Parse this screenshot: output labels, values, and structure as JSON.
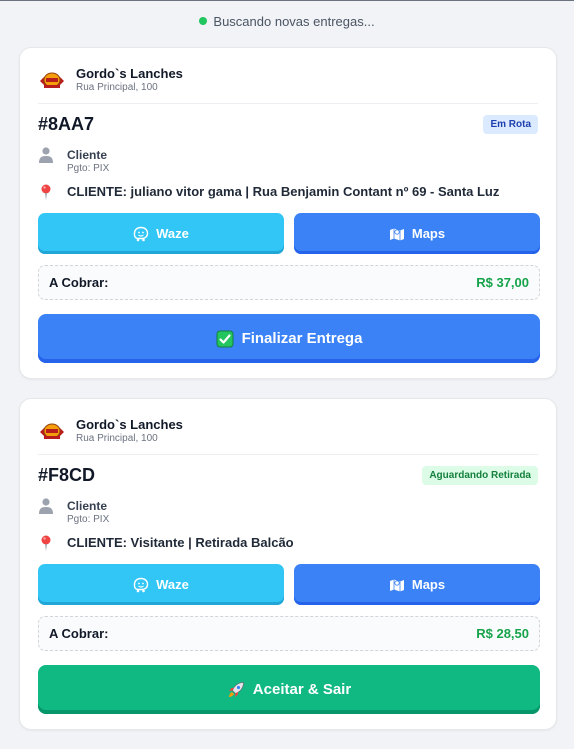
{
  "status": {
    "text": "Buscando novas entregas..."
  },
  "colors": {
    "accent": "#3b82f6",
    "waze": "#31c6f5",
    "success": "#10b981",
    "money": "#16a34a"
  },
  "orders": [
    {
      "store_name": "Gordo`s Lanches",
      "store_address": "Rua Principal, 100",
      "code": "#8AA7",
      "status_badge": "Em Rota",
      "customer_label": "Cliente",
      "payment": "Pgto: PIX",
      "address": "CLIENTE: juliano vitor gama | Rua Benjamin Contant nº 69 - Santa Luz",
      "waze_label": "Waze",
      "maps_label": "Maps",
      "charge_label": "A Cobrar:",
      "charge_value": "R$ 37,00",
      "action_label": "Finalizar Entrega",
      "action_icon": "check-box-icon"
    },
    {
      "store_name": "Gordo`s Lanches",
      "store_address": "Rua Principal, 100",
      "code": "#F8CD",
      "status_badge": "Aguardando Retirada",
      "customer_label": "Cliente",
      "payment": "Pgto: PIX",
      "address": "CLIENTE: Visitante | Retirada Balcão",
      "waze_label": "Waze",
      "maps_label": "Maps",
      "charge_label": "A Cobrar:",
      "charge_value": "R$ 28,50",
      "action_label": "Aceitar & Sair",
      "action_icon": "rocket-icon"
    }
  ]
}
